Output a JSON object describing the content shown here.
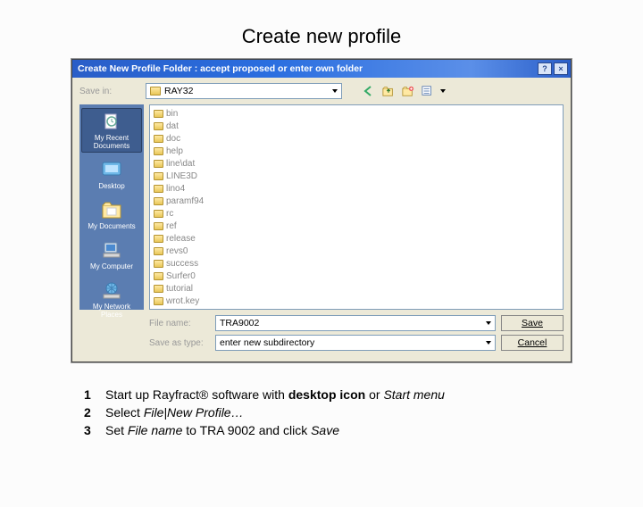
{
  "slide": {
    "title": "Create new profile"
  },
  "dialog": {
    "titlebar": "Create New Profile Folder : accept proposed or enter own folder",
    "savein_label": "Save in:",
    "savein_value": "RAY32",
    "places": [
      {
        "key": "recent",
        "name": "My Recent Documents"
      },
      {
        "key": "desktop",
        "name": "Desktop"
      },
      {
        "key": "mydocs",
        "name": "My Documents"
      },
      {
        "key": "mycomp",
        "name": "My Computer"
      },
      {
        "key": "network",
        "name": "My Network Places"
      }
    ],
    "files": [
      "bin",
      "dat",
      "doc",
      "help",
      "line\\dat",
      "LINE3D",
      "lino4",
      "paramf94",
      "rc",
      "ref",
      "release",
      "revs0",
      "success",
      "Surfer0",
      "tutorial",
      "wrot.key"
    ],
    "filename_label": "File name:",
    "filename_value": "TRA9002",
    "savetype_label": "Save as type:",
    "savetype_value": "enter new subdirectory",
    "save_btn": "Save",
    "cancel_btn": "Cancel"
  },
  "instructions": {
    "items": [
      {
        "n": "1",
        "pre": "Start up Rayfract® software with ",
        "bold1": "desktop icon",
        "mid": " or ",
        "ital1": "Start menu"
      },
      {
        "n": "2",
        "pre": "Select ",
        "ital1": "File|New Profile…"
      },
      {
        "n": "3",
        "pre": "Set ",
        "ital1": "File name",
        "mid": " to TRA 9002 and click ",
        "ital2": "Save"
      }
    ]
  }
}
